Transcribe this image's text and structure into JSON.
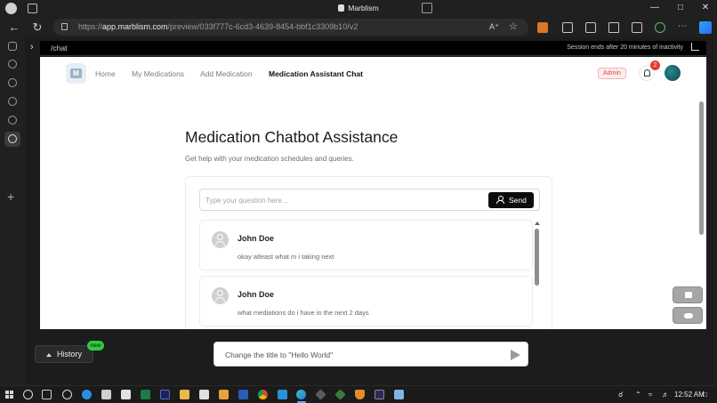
{
  "browser": {
    "window_title": "Marblism",
    "url_host": "app.marblism.com",
    "url_prefix": "https://",
    "url_path": "/preview/033f777c-6cd3-4639-8454-bbf1c3309b10/v2"
  },
  "preview_bar": {
    "path": "/chat",
    "session_note": "Session ends after 20 minutes of inactivity"
  },
  "app_nav": {
    "logo_letter": "M",
    "links": [
      {
        "label": "Home"
      },
      {
        "label": "My Medications"
      },
      {
        "label": "Add Medication"
      },
      {
        "label": "Medication Assistant Chat",
        "active": true
      }
    ],
    "admin_badge": "Admin",
    "notification_count": "2"
  },
  "page": {
    "title": "Medication Chatbot Assistance",
    "subtitle": "Get help with your medication schedules and queries."
  },
  "chat": {
    "input_placeholder": "Type your question here...",
    "send_label": "Send",
    "messages": [
      {
        "author": "John Doe",
        "text": "okay atleast what m i taking next"
      },
      {
        "author": "John Doe",
        "text": "what mediations do i have in the next 2 days"
      }
    ]
  },
  "bottom": {
    "history_label": "History",
    "new_badge": "new",
    "prompt_placeholder": "Change the title to \"Hello World\""
  },
  "taskbar": {
    "time": "12:52 AM"
  },
  "colors": {
    "primary_button": "#0c0c0c",
    "admin_badge_text": "#d94848",
    "notification_badge": "#e53935",
    "new_badge": "#2ecc40"
  }
}
